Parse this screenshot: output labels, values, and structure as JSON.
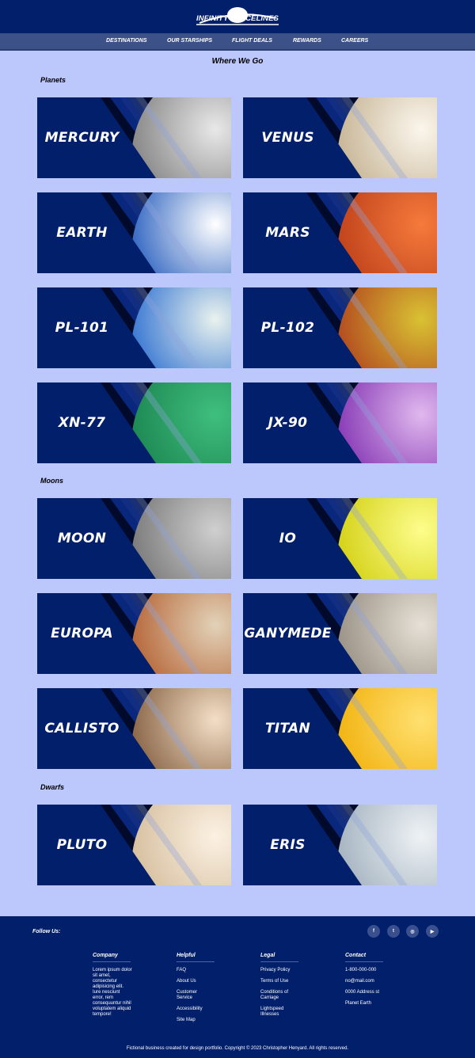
{
  "brand": {
    "name": "INFINITY SPACELINES"
  },
  "nav": [
    {
      "label": "DESTINATIONS"
    },
    {
      "label": "OUR STARSHIPS"
    },
    {
      "label": "FLIGHT DEALS"
    },
    {
      "label": "REWARDS"
    },
    {
      "label": "CAREERS"
    }
  ],
  "page": {
    "title": "Where We Go"
  },
  "sections": [
    {
      "title": "Planets",
      "cards": [
        {
          "name": "MERCURY",
          "icon": "mercury-image",
          "colors": [
            "#e8e8e8",
            "#8a8a8a",
            "#3c3c3c"
          ]
        },
        {
          "name": "VENUS",
          "icon": "venus-image",
          "colors": [
            "#fbf6ec",
            "#c9b89a",
            "#6e6250"
          ]
        },
        {
          "name": "EARTH",
          "icon": "earth-image",
          "colors": [
            "#ffffff",
            "#3b6dc4",
            "#0c1f63"
          ]
        },
        {
          "name": "MARS",
          "icon": "mars-image",
          "colors": [
            "#f57a3b",
            "#c2451d",
            "#5e1a08"
          ]
        },
        {
          "name": "PL-101",
          "icon": "pl-101-image",
          "colors": [
            "#e9f2ee",
            "#3f7cd3",
            "#1e4aa3"
          ]
        },
        {
          "name": "PL-102",
          "icon": "pl-102-image",
          "colors": [
            "#d9c233",
            "#b44f20",
            "#6b2208"
          ]
        },
        {
          "name": "XN-77",
          "icon": "xn-77-image",
          "colors": [
            "#3fbf7d",
            "#1f8a55",
            "#0b4a2c"
          ]
        },
        {
          "name": "JX-90",
          "icon": "jx-90-image",
          "colors": [
            "#e0b8ee",
            "#8b3fb8",
            "#3f1666"
          ]
        }
      ]
    },
    {
      "title": "Moons",
      "cards": [
        {
          "name": "MOON",
          "icon": "moon-image",
          "colors": [
            "#cfcfcf",
            "#7e7e7e",
            "#2f2f2f"
          ]
        },
        {
          "name": "IO",
          "icon": "io-image",
          "colors": [
            "#fdfd8c",
            "#d6d31c",
            "#6d6a08"
          ]
        },
        {
          "name": "EUROPA",
          "icon": "europa-image",
          "colors": [
            "#e2d2b8",
            "#b86b3e",
            "#5a2d16"
          ]
        },
        {
          "name": "GANYMEDE",
          "icon": "ganymede-image",
          "colors": [
            "#e6e0d6",
            "#9d9589",
            "#4b463f"
          ]
        },
        {
          "name": "CALLISTO",
          "icon": "callisto-image",
          "colors": [
            "#f3dfc6",
            "#8e6a4c",
            "#2e5e45"
          ]
        },
        {
          "name": "TITAN",
          "icon": "titan-image",
          "colors": [
            "#ffe070",
            "#f2b515",
            "#b67800"
          ]
        }
      ]
    },
    {
      "title": "Dwarfs",
      "cards": [
        {
          "name": "PLUTO",
          "icon": "pluto-image",
          "colors": [
            "#fbf1e2",
            "#d8c1a2",
            "#6d5a47"
          ]
        },
        {
          "name": "ERIS",
          "icon": "eris-image",
          "colors": [
            "#eef2f5",
            "#a8b6c2",
            "#4a5663"
          ]
        }
      ]
    }
  ],
  "footer": {
    "follow_label": "Follow Us:",
    "social": [
      {
        "icon": "facebook-icon",
        "glyph": "f"
      },
      {
        "icon": "twitter-icon",
        "glyph": "t"
      },
      {
        "icon": "instagram-icon",
        "glyph": "◎"
      },
      {
        "icon": "youtube-icon",
        "glyph": "▶"
      }
    ],
    "company": {
      "heading": "Company",
      "text": "Lorem ipsum dolor sit amet, consectetur adipisicing elit. Iure nesciunt error, rem consequuntur nihil voluptatem aliquid tempore!"
    },
    "helpful": {
      "heading": "Helpful",
      "links": [
        "FAQ",
        "About Us",
        "Customer Service",
        "Accessibility",
        "Site Map"
      ]
    },
    "legal": {
      "heading": "Legal",
      "links": [
        "Privacy Policy",
        "Terms of Use",
        "Conditions of Carriage",
        "Lightspeed Illnesses"
      ]
    },
    "contact": {
      "heading": "Contact",
      "lines": [
        "1-800-000-000",
        "no@mail.com",
        "0000 Address st",
        "Planet Earth"
      ]
    },
    "copyright": "Fictional business created for design portfolio. Copyright © 2023 Christopher Henyard. All rights reserved."
  }
}
